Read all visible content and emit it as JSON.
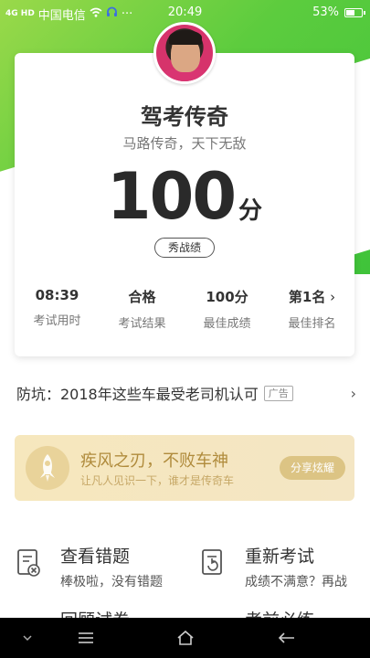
{
  "status_bar": {
    "signal_text": "4G HD",
    "carrier": "中国电信",
    "time": "20:49",
    "battery": "53%",
    "battery_level": 0.53,
    "more": "···"
  },
  "result_card": {
    "title": "驾考传奇",
    "subtitle": "马路传奇，天下无敌",
    "score": "100",
    "score_unit": "分",
    "show_button": "秀战绩",
    "stats": [
      {
        "value": "08:39",
        "label": "考试用时"
      },
      {
        "value": "合格",
        "label": "考试结果"
      },
      {
        "value": "100分",
        "label": "最佳成绩"
      },
      {
        "value": "第1名",
        "label": "最佳排名"
      }
    ]
  },
  "ad": {
    "text": "防坑：2018年这些车最受老司机认可",
    "badge": "广告",
    "arrow": "›"
  },
  "banner": {
    "heading": "疾风之刃，不败车神",
    "subtext": "让凡人见识一下，谁才是传奇车",
    "share_button": "分享炫耀"
  },
  "actions": [
    {
      "title": "查看错题",
      "subtitle": "棒极啦，没有错题"
    },
    {
      "title": "重新考试",
      "subtitle": "成绩不满意？再战"
    },
    {
      "title": "回顾试卷",
      "subtitle": ""
    },
    {
      "title": "考前必练",
      "subtitle": ""
    }
  ],
  "colors": {
    "green": "#4cc83c",
    "gold": "#b08b3c",
    "banner_bg": "#f5e7c0"
  }
}
